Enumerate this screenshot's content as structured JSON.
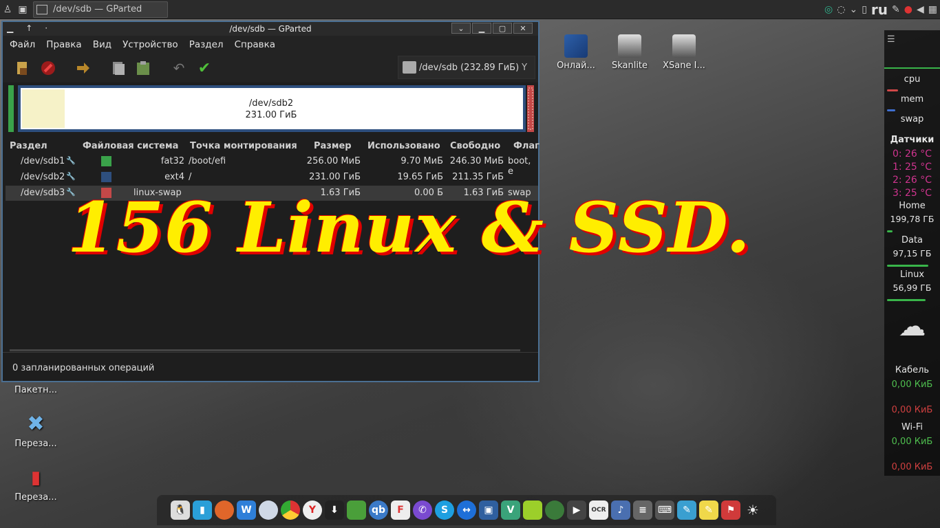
{
  "taskbar": {
    "task_title": "/dev/sdb — GParted",
    "language": "ru"
  },
  "window": {
    "title": "/dev/sdb — GParted",
    "menu": [
      "Файл",
      "Правка",
      "Вид",
      "Устройство",
      "Раздел",
      "Справка"
    ],
    "device_selector": "/dev/sdb (232.89 ГиБ)",
    "disk_map": {
      "label": "/dev/sdb2",
      "size": "231.00 ГиБ"
    },
    "columns": [
      "Раздел",
      "Файловая система",
      "Точка монтирования",
      "Размер",
      "Использовано",
      "Свободно",
      "Флаг"
    ],
    "partitions": [
      {
        "name": "/dev/sdb1",
        "fs": "fat32",
        "mount": "/boot/efi",
        "size": "256.00 МиБ",
        "used": "9.70 МиБ",
        "free": "246.30 МиБ",
        "flags": "boot, e",
        "color": "#3aa24a"
      },
      {
        "name": "/dev/sdb2",
        "fs": "ext4",
        "mount": "/",
        "size": "231.00 ГиБ",
        "used": "19.65 ГиБ",
        "free": "211.35 ГиБ",
        "flags": "",
        "color": "#2e4f7e"
      },
      {
        "name": "/dev/sdb3",
        "fs": "linux-swap",
        "mount": "",
        "size": "1.63 ГиБ",
        "used": "0.00 Б",
        "free": "1.63 ГиБ",
        "flags": "swap",
        "color": "#c44848"
      }
    ],
    "status": "0 запланированных операций"
  },
  "headline": "156 Linux & SSD.",
  "desktop_icons": [
    {
      "label": "Онлай...",
      "icon": "book-icon"
    },
    {
      "label": "Skanlite",
      "icon": "scanner-icon"
    },
    {
      "label": "XSane I...",
      "icon": "scanner-icon"
    },
    {
      "label": "Пакетн...",
      "icon": "package-icon"
    },
    {
      "label": "Переза...",
      "icon": "tools-icon"
    },
    {
      "label": "Переза...",
      "icon": "usb-icon"
    }
  ],
  "conky": {
    "cpu": "cpu",
    "mem": "mem",
    "swap": "swap",
    "sensors_title": "Датчики",
    "temps": [
      "0: 26 °C",
      "1: 25 °C",
      "2: 26 °C",
      "3: 25 °C"
    ],
    "disks": [
      {
        "name": "Home",
        "size": "199,78 ГБ"
      },
      {
        "name": "Data",
        "size": "97,15 ГБ"
      },
      {
        "name": "Linux",
        "size": "56,99 ГБ"
      }
    ],
    "cable": "Кабель",
    "cable_down": "0,00 КиБ",
    "cable_up": "0,00 КиБ",
    "wifi": "Wi-Fi",
    "wifi_down": "0,00 КиБ",
    "wifi_up": "0,00 КиБ"
  },
  "colors": {
    "accent": "#ffee00",
    "headline_shadow": "#e00000",
    "window_border": "#4b6f92"
  }
}
